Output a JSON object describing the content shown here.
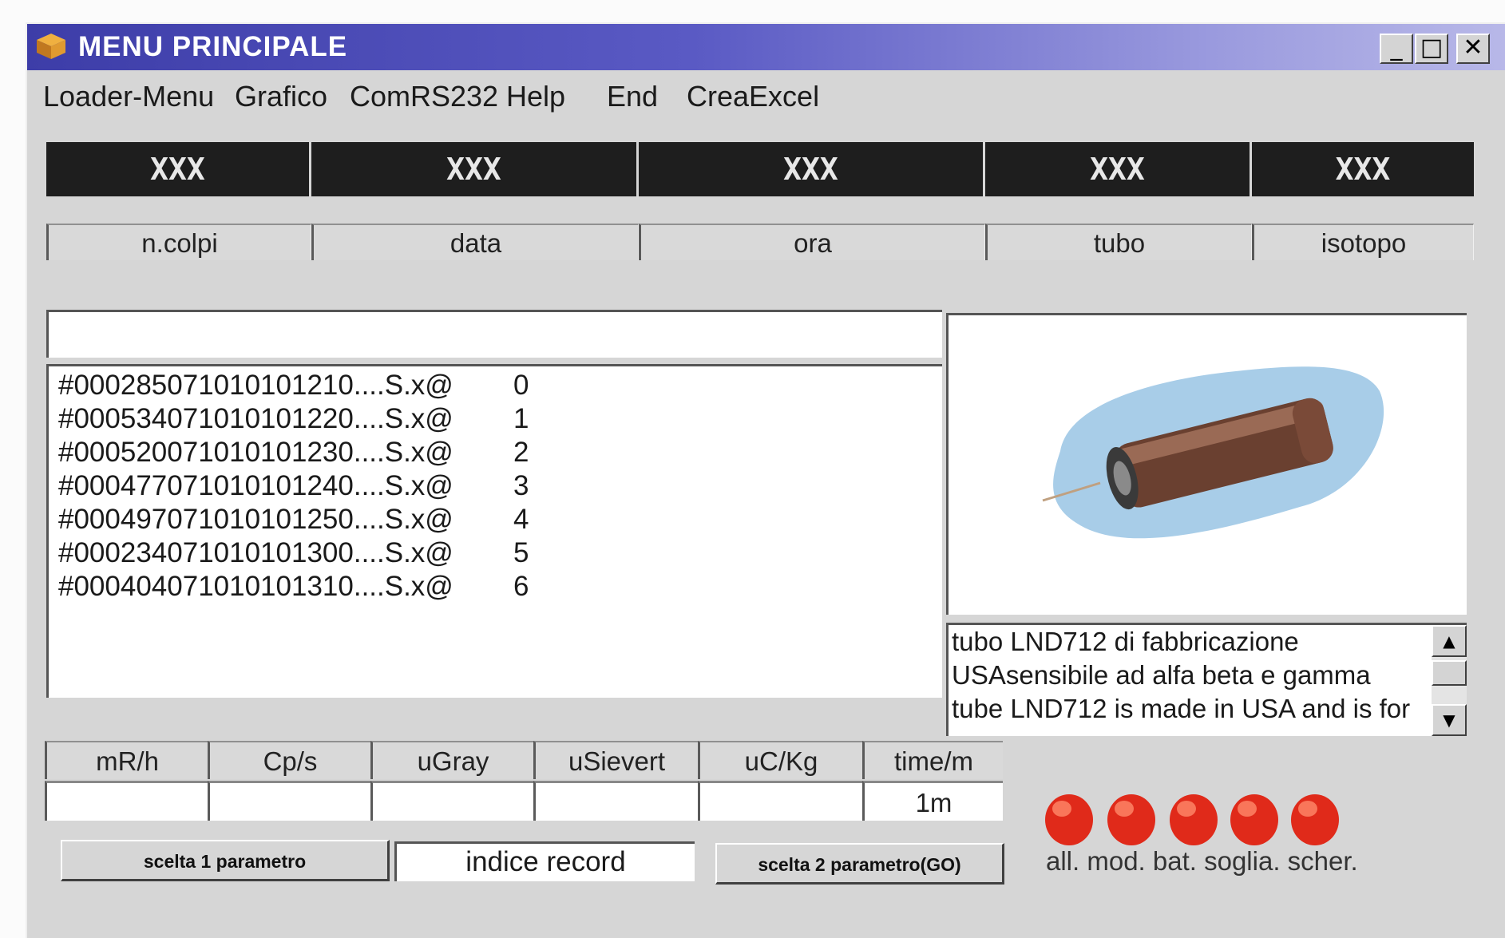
{
  "window": {
    "title": "MENU PRINCIPALE",
    "controls": [
      "_",
      "□",
      "✕"
    ]
  },
  "menu": [
    "Loader-Menu",
    "Grafico",
    "ComRS232",
    "Help",
    "End",
    "CreaExcel"
  ],
  "info_headers": [
    {
      "value": "XXX",
      "label": "n.colpi"
    },
    {
      "value": "XXX",
      "label": "data"
    },
    {
      "value": "XXX",
      "label": "ora"
    },
    {
      "value": "XXX",
      "label": "tubo"
    },
    {
      "value": "XXX",
      "label": "isotopo"
    }
  ],
  "records": [
    {
      "code": "#000285071010101210....S.x@",
      "index": "0"
    },
    {
      "code": "#000534071010101220....S.x@",
      "index": "1"
    },
    {
      "code": "#000520071010101230....S.x@",
      "index": "2"
    },
    {
      "code": "#000477071010101240....S.x@",
      "index": "3"
    },
    {
      "code": "#000497071010101250....S.x@",
      "index": "4"
    },
    {
      "code": "#000234071010101300....S.x@",
      "index": "5"
    },
    {
      "code": "#000404071010101310....S.x@",
      "index": "6"
    }
  ],
  "tube_description": [
    "tubo  LND712 di  fabbricazione",
    "USAsensibile ad alfa beta e gamma",
    "tube LND712 is made in USA and is for"
  ],
  "units": [
    {
      "label": "mR/h",
      "value": ""
    },
    {
      "label": "Cp/s",
      "value": ""
    },
    {
      "label": "uGray",
      "value": ""
    },
    {
      "label": "uSievert",
      "value": ""
    },
    {
      "label": "uC/Kg",
      "value": ""
    },
    {
      "label": "time/m",
      "value": "1m"
    }
  ],
  "buttons": {
    "choice1": "scelta 1 parametro",
    "record_index": "indice record",
    "choice2": "scelta 2 parametro(GO)"
  },
  "indicators": {
    "labels": "all. mod. bat. soglia. scher.",
    "names": [
      "all.",
      "mod.",
      "bat.",
      "soglia.",
      "scher."
    ],
    "color": "#e02a1a"
  }
}
